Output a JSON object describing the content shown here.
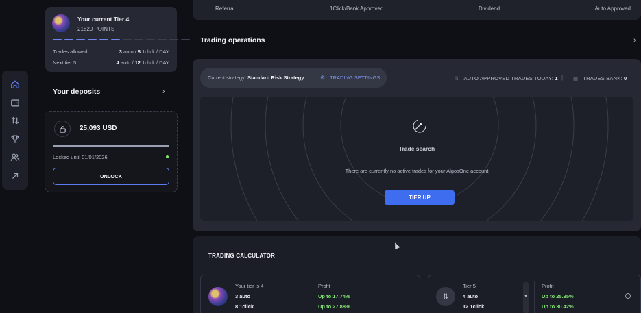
{
  "sidebar": {
    "items": [
      {
        "icon": "home-icon",
        "active": true
      },
      {
        "icon": "wallet-icon"
      },
      {
        "icon": "transfer-arrows-icon"
      },
      {
        "icon": "trophy-icon"
      },
      {
        "icon": "users-icon"
      },
      {
        "icon": "arrow-up-right-icon"
      }
    ]
  },
  "tier_card": {
    "title": "Your current Tier 4",
    "points": "21820 POINTS",
    "progress_segments_total": 12,
    "progress_segments_filled": 6,
    "trades_allowed_label": "Trades allowed",
    "trades_allowed_value_a": "3",
    "trades_allowed_value_a_suffix": " auto / ",
    "trades_allowed_value_b": "8",
    "trades_allowed_value_b_suffix": " 1click / DAY",
    "next_tier_label": "Next tier 5",
    "next_tier_value_a": "4",
    "next_tier_value_a_suffix": " auto / ",
    "next_tier_value_b": "12",
    "next_tier_value_b_suffix": " 1click / DAY"
  },
  "deposits": {
    "title": "Your deposits",
    "amount": "25,093 USD",
    "locked_until": "Locked until 01/01/2026",
    "lock_progress_fraction": 1.0,
    "status_color": "#7fe36f",
    "unlock_label": "UNLOCK"
  },
  "stats_strip": {
    "referral_label": "Referral",
    "approved_label": "1Click/Bank Approved",
    "dividend_label": "Dividend",
    "auto_approved_label": "Auto Approved"
  },
  "operations": {
    "title": "Trading operations",
    "strategy_label": "Current strategy: ",
    "strategy_value": "Standard Risk Strategy",
    "settings_label": "TRADING SETTINGS",
    "auto_approved_label": "AUTO APPROVED TRADES TODAY: ",
    "auto_approved_value": "1",
    "separator": "|",
    "trades_bank_label": "TRADES BANK: ",
    "trades_bank_value": "0",
    "search_title": "Trade search",
    "empty_message": "There are currently no active trades for your AlgosOne account",
    "tier_up_label": "TIER UP"
  },
  "calculator": {
    "title": "TRADING CALCULATOR",
    "current": {
      "tier_label": "Your tier is 4",
      "auto": "3 auto",
      "oneclick": "8 1click",
      "profit_label": "Profit",
      "profit_1": "Up to 17.74%",
      "profit_2": "Up to 27.88%"
    },
    "next": {
      "tier_label": "Tier 5",
      "auto": "4 auto",
      "oneclick": "12 1click",
      "profit_label": "Profit",
      "profit_1": "Up to 25.35%",
      "profit_2": "Up to 30.42%"
    }
  },
  "colors": {
    "accent": "#3f6df0",
    "accent_text": "#7d94f4",
    "positive": "#7fe36f",
    "panel": "#262833",
    "background": "#0f1015"
  }
}
